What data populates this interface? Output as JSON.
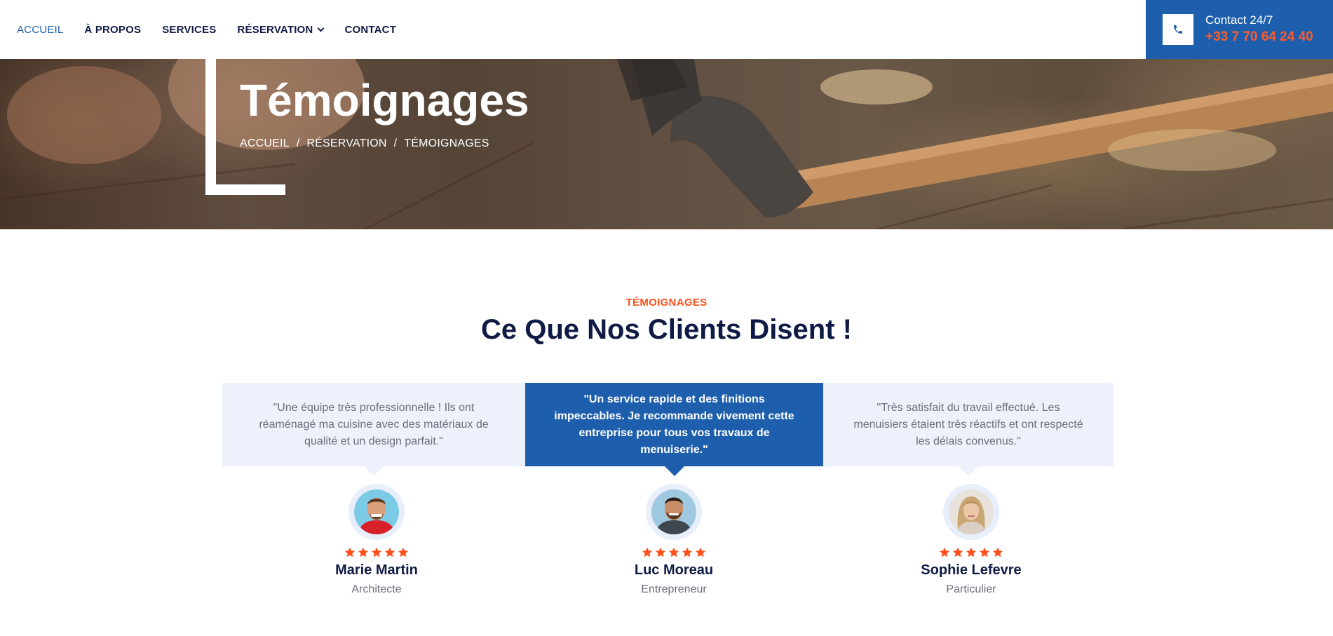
{
  "nav": {
    "items": [
      {
        "label": "ACCUEIL",
        "active": true
      },
      {
        "label": "À PROPOS"
      },
      {
        "label": "SERVICES"
      },
      {
        "label": "RÉSERVATION",
        "dropdown": true
      },
      {
        "label": "CONTACT"
      }
    ],
    "dropdown_icon": "chevron-down-icon"
  },
  "contact": {
    "label": "Contact 24/7",
    "phone": "+33 7 70 64 24 40",
    "icon": "phone-icon"
  },
  "hero": {
    "title": "Témoignages",
    "breadcrumb": [
      "ACCUEIL",
      "RÉSERVATION",
      "TÉMOIGNAGES"
    ],
    "separator": "/"
  },
  "section": {
    "eyebrow": "TÉMOIGNAGES",
    "heading": "Ce Que Nos Clients Disent !"
  },
  "testimonials": [
    {
      "quote": "\"Une équipe très professionnelle ! Ils ont réaménagé ma cuisine avec des matériaux de qualité et un design parfait.\"",
      "name": "Marie Martin",
      "role": "Architecte",
      "rating": 5,
      "highlighted": false
    },
    {
      "quote": "\"Un service rapide et des finitions impeccables. Je recommande vivement cette entreprise pour tous vos travaux de menuiserie.\"",
      "name": "Luc Moreau",
      "role": "Entrepreneur",
      "rating": 5,
      "highlighted": true
    },
    {
      "quote": "\"Très satisfait du travail effectué. Les menuisiers étaient très réactifs et ont respecté les délais convenus.\"",
      "name": "Sophie Lefevre",
      "role": "Particulier",
      "rating": 5,
      "highlighted": false
    }
  ],
  "colors": {
    "primary": "#1e5fad",
    "accent": "#ff4f1a",
    "dark": "#0f1b44",
    "card_light": "#edf1fb",
    "muted": "#6b6f7d"
  }
}
